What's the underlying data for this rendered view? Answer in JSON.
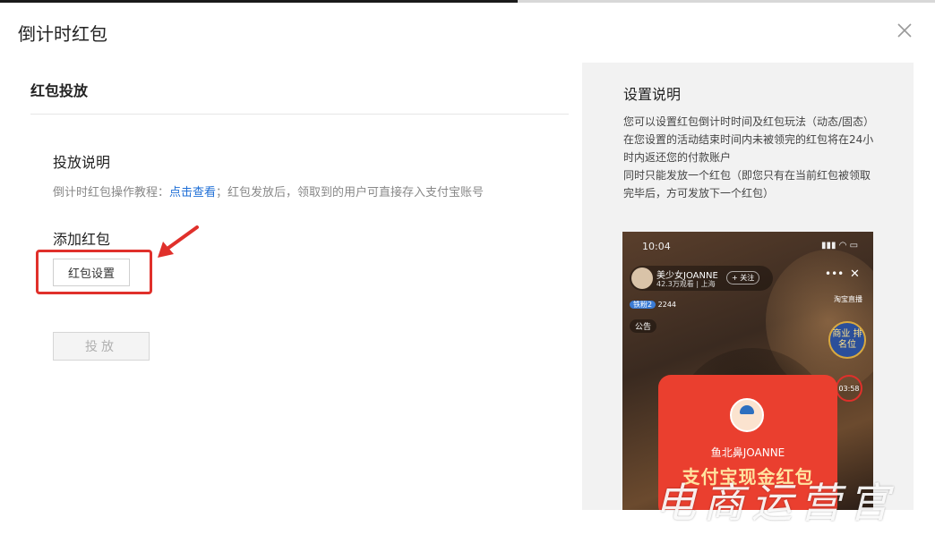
{
  "dialog": {
    "title": "倒计时红包"
  },
  "left": {
    "section_title": "红包投放",
    "instructions_title": "投放说明",
    "instructions": {
      "prefix": "倒计时红包操作教程：",
      "link": "点击查看",
      "suffix": "；红包发放后，领取到的用户可直接存入支付宝账号"
    },
    "add_title": "添加红包",
    "setting_button": "红包设置",
    "deliver_button": "投放"
  },
  "right": {
    "title": "设置说明",
    "lines": [
      "您可以设置红包倒计时时间及红包玩法（动态/固态）",
      "在您设置的活动结束时间内未被领完的红包将在24小时内返还您的付款账户",
      "同时只能发放一个红包（即您只有在当前红包被领取完毕后，方可发放下一个红包）"
    ]
  },
  "phone": {
    "time": "10:04",
    "host_name": "美少女JOANNE",
    "host_sub": "42.3万观看 | 上海",
    "follow": "+ 关注",
    "fans_badge": "铁粉2",
    "fans_count": "2244",
    "notice": "公告",
    "rank_tag": "淘宝直播",
    "rank": "商业 排名位",
    "timer": "03:58",
    "card_name": "鱼北鼻JOANNE",
    "card_title": "支付宝现金红包"
  },
  "watermark": "电商运营官",
  "colors": {
    "accent_red": "#e0302b",
    "link_blue": "#1f6fd6",
    "panel_bg": "#f2f2f2"
  }
}
